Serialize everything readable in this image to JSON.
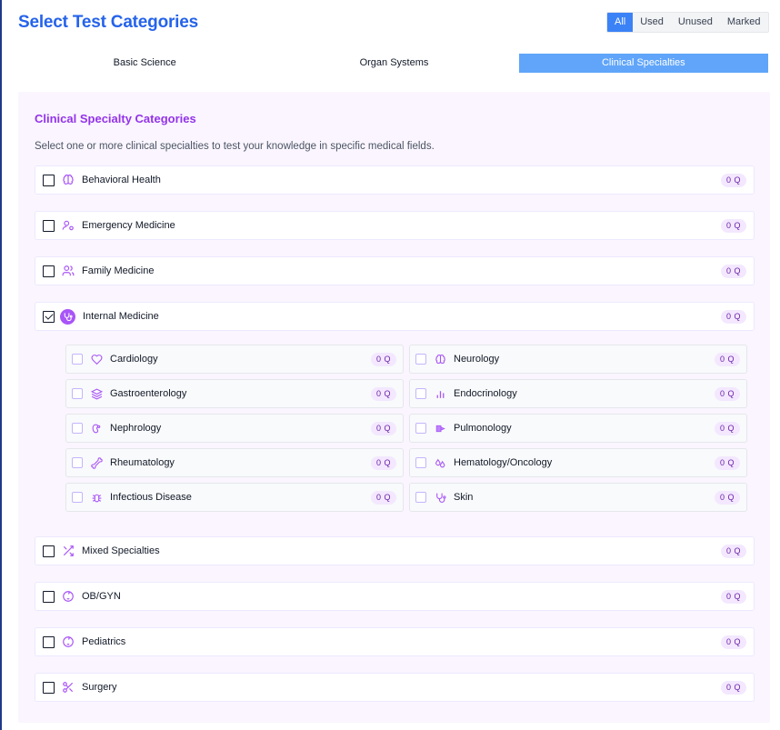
{
  "header": {
    "title": "Select Test Categories",
    "filters": [
      {
        "label": "All",
        "active": true
      },
      {
        "label": "Used",
        "active": false
      },
      {
        "label": "Unused",
        "active": false
      },
      {
        "label": "Marked",
        "active": false
      }
    ]
  },
  "tabs": [
    {
      "label": "Basic Science",
      "active": false
    },
    {
      "label": "Organ Systems",
      "active": false
    },
    {
      "label": "Clinical Specialties",
      "active": true
    }
  ],
  "panel": {
    "title": "Clinical Specialty Categories",
    "description": "Select one or more clinical specialties to test your knowledge in specific medical fields."
  },
  "categories": [
    {
      "label": "Behavioral Health",
      "icon": "brain-icon",
      "count": "0 Q",
      "checked": false
    },
    {
      "label": "Emergency Medicine",
      "icon": "user-cog-icon",
      "count": "0 Q",
      "checked": false
    },
    {
      "label": "Family Medicine",
      "icon": "users-icon",
      "count": "0 Q",
      "checked": false
    },
    {
      "label": "Internal Medicine",
      "icon": "stethoscope-icon",
      "count": "0 Q",
      "checked": true
    },
    {
      "label": "Mixed Specialties",
      "icon": "shuffle-icon",
      "count": "0 Q",
      "checked": false
    },
    {
      "label": "OB/GYN",
      "icon": "baby-icon",
      "count": "0 Q",
      "checked": false
    },
    {
      "label": "Pediatrics",
      "icon": "baby-icon",
      "count": "0 Q",
      "checked": false
    },
    {
      "label": "Surgery",
      "icon": "scissors-icon",
      "count": "0 Q",
      "checked": false
    }
  ],
  "subcategories": [
    {
      "label": "Cardiology",
      "icon": "heart-icon",
      "count": "0 Q",
      "checked": false
    },
    {
      "label": "Neurology",
      "icon": "brain-icon",
      "count": "0 Q",
      "checked": false
    },
    {
      "label": "Gastroenterology",
      "icon": "layers-icon",
      "count": "0 Q",
      "checked": false
    },
    {
      "label": "Endocrinology",
      "icon": "bar-chart-icon",
      "count": "0 Q",
      "checked": false
    },
    {
      "label": "Nephrology",
      "icon": "kidney-icon",
      "count": "0 Q",
      "checked": false
    },
    {
      "label": "Pulmonology",
      "icon": "lungs-icon",
      "count": "0 Q",
      "checked": false
    },
    {
      "label": "Rheumatology",
      "icon": "bone-icon",
      "count": "0 Q",
      "checked": false
    },
    {
      "label": "Hematology/Oncology",
      "icon": "droplets-icon",
      "count": "0 Q",
      "checked": false
    },
    {
      "label": "Infectious Disease",
      "icon": "bug-icon",
      "count": "0 Q",
      "checked": false
    },
    {
      "label": "Skin",
      "icon": "stethoscope-icon",
      "count": "0 Q",
      "checked": false
    }
  ],
  "colors": {
    "accent": "#2563eb",
    "tab_active": "#60a5fa",
    "purple": "#a855f7",
    "panel_bg": "#faf5ff"
  }
}
